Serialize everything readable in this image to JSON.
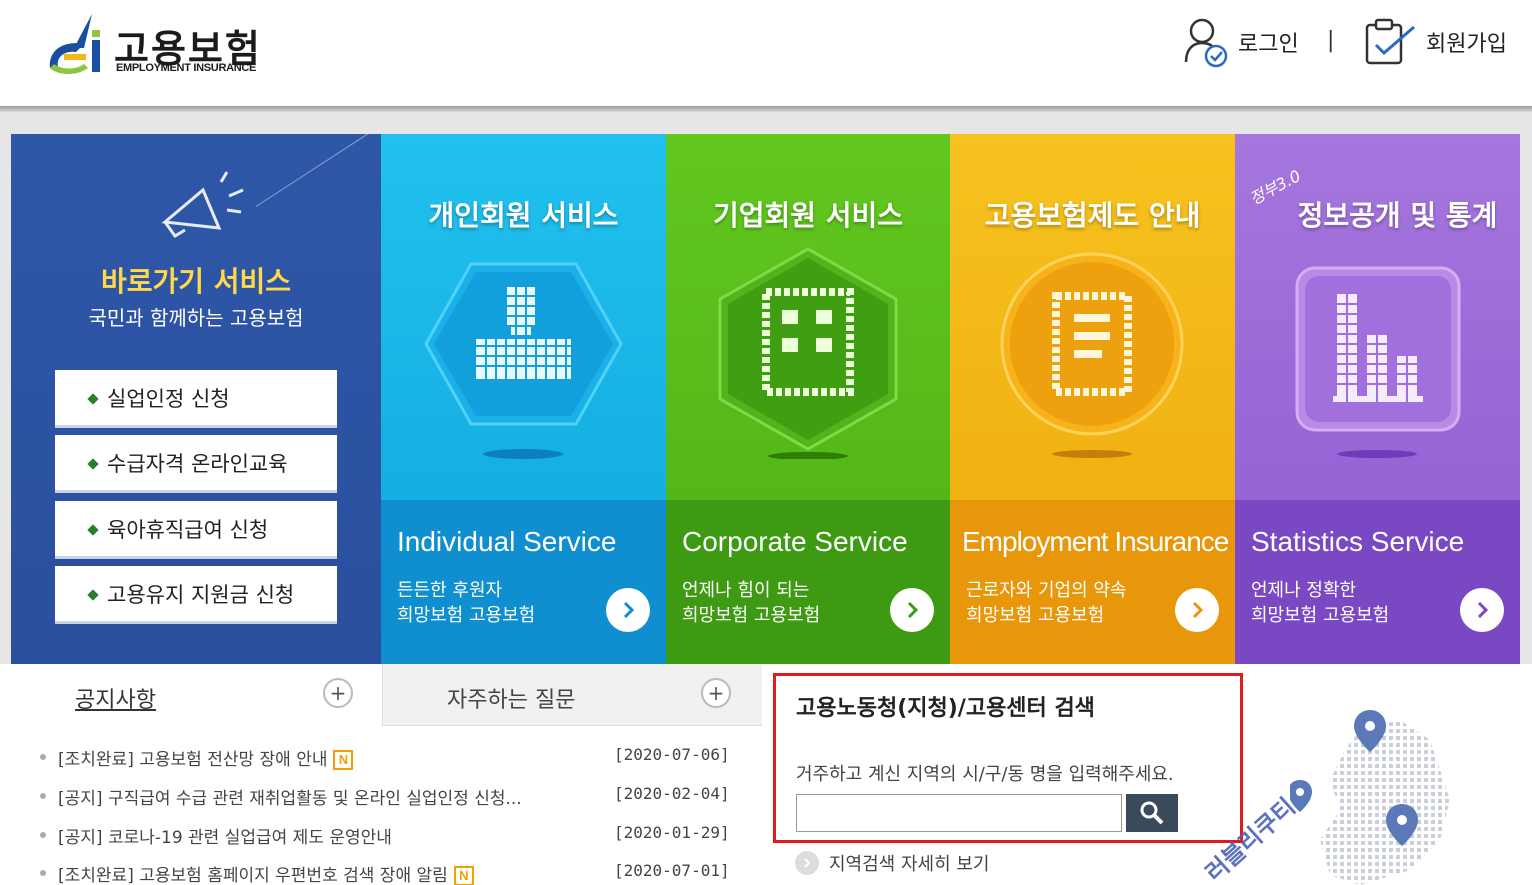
{
  "header": {
    "logo_ko": "고용보험",
    "logo_en": "EMPLOYMENT INSURANCE",
    "login_label": "로그인",
    "separator": "|",
    "join_label": "회원가입"
  },
  "quick": {
    "title": "바로가기 서비스",
    "subtitle": "국민과 함께하는 고용보험",
    "buttons": [
      "실업인정 신청",
      "수급자격 온라인교육",
      "육아휴직급여 신청",
      "고용유지 지원금 신청"
    ]
  },
  "tiles": [
    {
      "title": "개인회원 서비스",
      "en": "Individual Service",
      "desc1": "든든한 후원자",
      "desc2": "희망보험 고용보험",
      "color_top": "#12b3e6",
      "color_bottom": "#0e8fcf"
    },
    {
      "title": "기업회원 서비스",
      "en": "Corporate Service",
      "desc1": "언제나 힘이 되는",
      "desc2": "희망보험 고용보험",
      "color_top": "#5cc21e",
      "color_bottom": "#3d9a12"
    },
    {
      "title": "고용보험제도 안내",
      "en": "Employment Insurance",
      "desc1": "근로자와 기업의 약속",
      "desc2": "희망보험 고용보험",
      "color_top": "#f2b81a",
      "color_bottom": "#e8960a"
    },
    {
      "title": "정보공개 및 통계",
      "title_badge": "정부3.0",
      "en": "Statistics Service",
      "desc1": "언제나 정확한",
      "desc2": "희망보험 고용보험",
      "color_top": "#9d6ad8",
      "color_bottom": "#7b48c4"
    }
  ],
  "notice": {
    "tab_label": "공지사항",
    "faq_label": "자주하는 질문",
    "items": [
      {
        "text": "[조치완료] 고용보험 전산망 장애 안내",
        "new": true,
        "date": "[2020-07-06]"
      },
      {
        "text": "[공지] 구직급여 수급 관련 재취업활동 및 온라인 실업인정 신청...",
        "new": false,
        "date": "[2020-02-04]"
      },
      {
        "text": "[공지] 코로나-19 관련 실업급여 제도 운영안내",
        "new": false,
        "date": "[2020-01-29]"
      },
      {
        "text": "[조치완료] 고용보험 홈페이지 우편번호 검색 장애 알림",
        "new": true,
        "date": "[2020-07-01]"
      }
    ],
    "new_badge": "N"
  },
  "search": {
    "title": "고용노동청(지청)/고용센터 검색",
    "description": "거주하고 계신 지역의 시/구/동 명을 입력해주세요.",
    "input_value": "",
    "detail_link": "지역검색 자세히 보기"
  },
  "watermark": "러블리쿠티",
  "colors": {
    "quick_bg": "#2f57a8",
    "highlight_border": "#e21a1a",
    "quick_title": "#ffd94a"
  }
}
